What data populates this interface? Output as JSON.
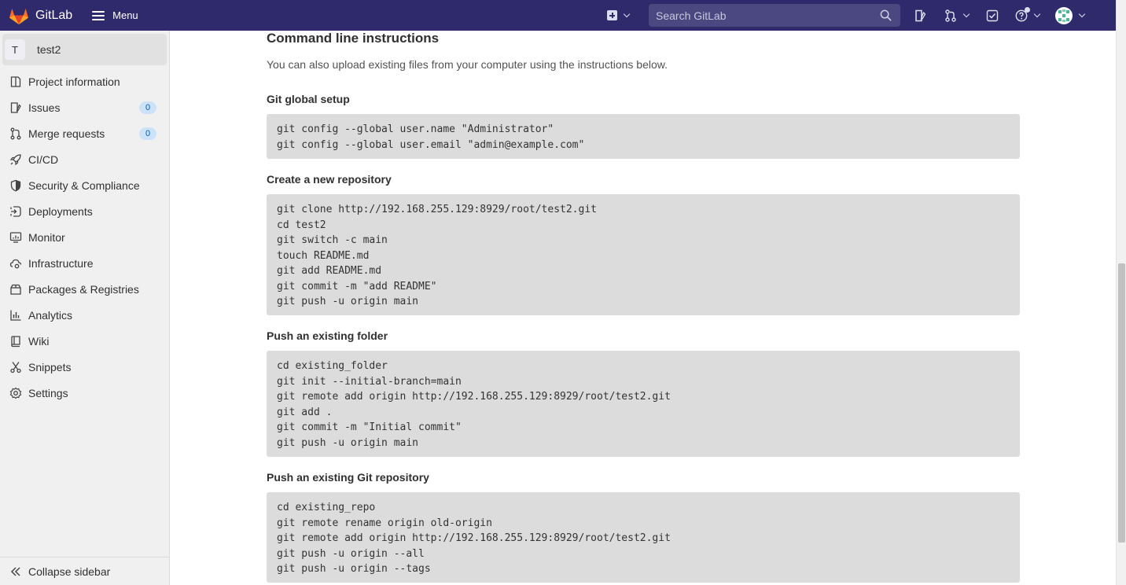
{
  "navbar": {
    "brand": "GitLab",
    "menu_label": "Menu",
    "search_placeholder": "Search GitLab"
  },
  "sidebar": {
    "project_avatar": "T",
    "project_name": "test2",
    "items": [
      {
        "label": "Project information",
        "icon": "project-icon"
      },
      {
        "label": "Issues",
        "icon": "issues-icon",
        "badge": "0"
      },
      {
        "label": "Merge requests",
        "icon": "merge-request-icon",
        "badge": "0"
      },
      {
        "label": "CI/CD",
        "icon": "rocket-icon"
      },
      {
        "label": "Security & Compliance",
        "icon": "shield-icon"
      },
      {
        "label": "Deployments",
        "icon": "deployments-icon"
      },
      {
        "label": "Monitor",
        "icon": "monitor-icon"
      },
      {
        "label": "Infrastructure",
        "icon": "cloud-gear-icon"
      },
      {
        "label": "Packages & Registries",
        "icon": "package-icon"
      },
      {
        "label": "Analytics",
        "icon": "chart-icon"
      },
      {
        "label": "Wiki",
        "icon": "book-icon"
      },
      {
        "label": "Snippets",
        "icon": "scissors-icon"
      },
      {
        "label": "Settings",
        "icon": "gear-icon"
      }
    ],
    "collapse_label": "Collapse sidebar"
  },
  "content": {
    "title": "Command line instructions",
    "lead": "You can also upload existing files from your computer using the instructions below.",
    "sections": [
      {
        "heading": "Git global setup",
        "code": "git config --global user.name \"Administrator\"\ngit config --global user.email \"admin@example.com\""
      },
      {
        "heading": "Create a new repository",
        "code": "git clone http://192.168.255.129:8929/root/test2.git\ncd test2\ngit switch -c main\ntouch README.md\ngit add README.md\ngit commit -m \"add README\"\ngit push -u origin main"
      },
      {
        "heading": "Push an existing folder",
        "code": "cd existing_folder\ngit init --initial-branch=main\ngit remote add origin http://192.168.255.129:8929/root/test2.git\ngit add .\ngit commit -m \"Initial commit\"\ngit push -u origin main"
      },
      {
        "heading": "Push an existing Git repository",
        "code": "cd existing_repo\ngit remote rename origin old-origin\ngit remote add origin http://192.168.255.129:8929/root/test2.git\ngit push -u origin --all\ngit push -u origin --tags"
      }
    ]
  },
  "colors": {
    "navbar_bg": "#2f2a6b",
    "sidebar_bg": "#f0f0f0",
    "code_bg": "#dcdcdc",
    "badge_bg": "#cbe2f9"
  }
}
